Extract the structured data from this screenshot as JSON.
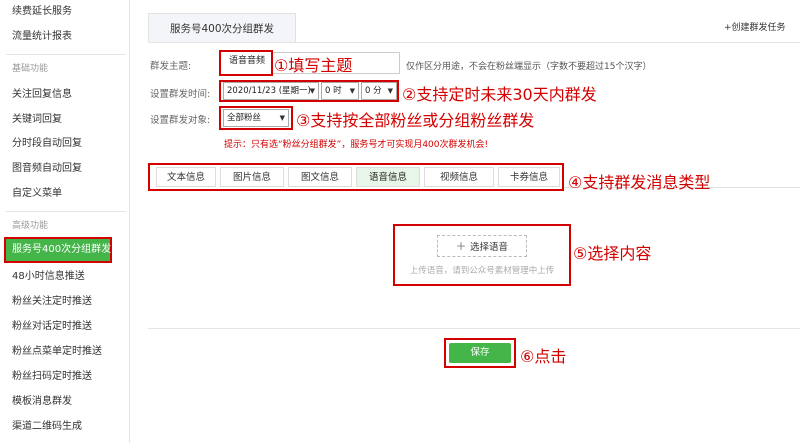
{
  "sidebar": {
    "items": [
      {
        "label": "续费延长服务"
      },
      {
        "label": "流量统计报表"
      },
      {
        "label": "基础功能"
      },
      {
        "label": "关注回复信息"
      },
      {
        "label": "关键词回复"
      },
      {
        "label": "分时段自动回复"
      },
      {
        "label": "图音频自动回复"
      },
      {
        "label": "自定义菜单"
      },
      {
        "label": "高级功能"
      },
      {
        "label": "服务号400次分组群发"
      },
      {
        "label": "48小时信息推送"
      },
      {
        "label": "粉丝关注定时推送"
      },
      {
        "label": "粉丝对话定时推送"
      },
      {
        "label": "粉丝点菜单定时推送"
      },
      {
        "label": "粉丝扫码定时推送"
      },
      {
        "label": "模板消息群发"
      },
      {
        "label": "渠道二维码生成"
      }
    ]
  },
  "header": {
    "title": "服务号400次分组群发",
    "create_link": "+创建群发任务"
  },
  "form": {
    "theme_label": "群发主题:",
    "theme_value": "语音音频",
    "theme_hint": "仅作区分用途，不会在粉丝端显示（字数不要超过15个汉字）",
    "time_label": "设置群发时间:",
    "date_value": "2020/11/23 (星期一)",
    "hour_value": "0 时",
    "minute_value": "0 分",
    "target_label": "设置群发对象:",
    "target_value": "全部粉丝",
    "warning": "提示：只有选“粉丝分组群发”，服务号才可实现月400次群发机会!"
  },
  "tabs": [
    {
      "label": "文本信息"
    },
    {
      "label": "图片信息"
    },
    {
      "label": "图文信息"
    },
    {
      "label": "语音信息"
    },
    {
      "label": "视频信息"
    },
    {
      "label": "卡券信息"
    }
  ],
  "content": {
    "choose_label": "选择语音",
    "upload_hint": "上传语音，请到公众号素材管理中上传"
  },
  "save_label": "保存",
  "annotations": {
    "a1": "①填写主题",
    "a2": "②支持定时未来30天内群发",
    "a3": "③支持按全部粉丝或分组粉丝群发",
    "a4": "④支持群发消息类型",
    "a5": "⑤选择内容",
    "a6": "⑥点击"
  },
  "colors": {
    "accent_green": "#44b549",
    "annotation_red": "#d40000"
  }
}
